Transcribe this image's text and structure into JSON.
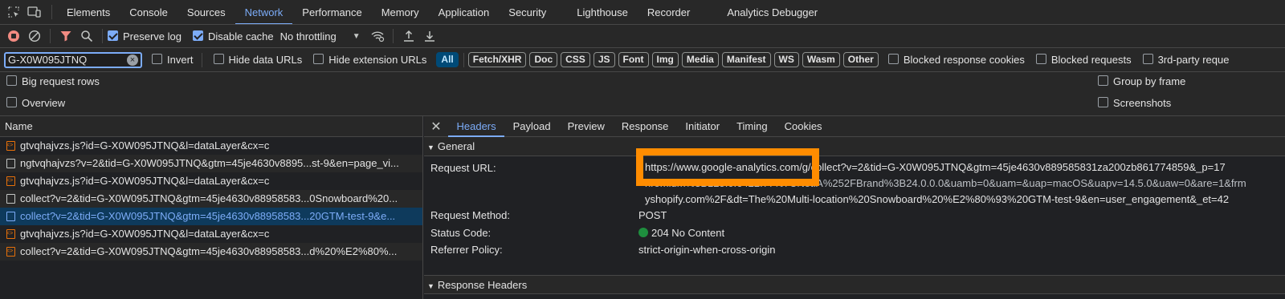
{
  "tabs": [
    "Elements",
    "Console",
    "Sources",
    "Network",
    "Performance",
    "Memory",
    "Application",
    "Security",
    "Lighthouse",
    "Recorder",
    "Analytics Debugger"
  ],
  "active_tab": "Network",
  "toolbar": {
    "preserve_log": "Preserve log",
    "disable_cache": "Disable cache",
    "throttling": "No throttling"
  },
  "filter": {
    "value": "G-X0W095JTNQ",
    "invert": "Invert",
    "hide_data_urls": "Hide data URLs",
    "hide_extension_urls": "Hide extension URLs",
    "types": [
      "All",
      "Fetch/XHR",
      "Doc",
      "CSS",
      "JS",
      "Font",
      "Img",
      "Media",
      "Manifest",
      "WS",
      "Wasm",
      "Other"
    ],
    "blocked_cookies": "Blocked response cookies",
    "blocked_requests": "Blocked requests",
    "third_party": "3rd-party reque"
  },
  "options": {
    "big_rows": "Big request rows",
    "overview": "Overview",
    "group_by_frame": "Group by frame",
    "screenshots": "Screenshots"
  },
  "requests": {
    "header": "Name",
    "items": [
      "gtvqhajvzs.js?id=G-X0W095JTNQ&l=dataLayer&cx=c",
      "ngtvqhajvzs?v=2&tid=G-X0W095JTNQ&gtm=45je4630v8895...st-9&en=page_vi...",
      "gtvqhajvzs.js?id=G-X0W095JTNQ&l=dataLayer&cx=c",
      "collect?v=2&tid=G-X0W095JTNQ&gtm=45je4630v88958583...0Snowboard%20...",
      "collect?v=2&tid=G-X0W095JTNQ&gtm=45je4630v88958583...20GTM-test-9&e...",
      "gtvqhajvzs.js?id=G-X0W095JTNQ&l=dataLayer&cx=c",
      "collect?v=2&tid=G-X0W095JTNQ&gtm=45je4630v88958583...d%20%E2%80%..."
    ]
  },
  "details": {
    "tabs": [
      "Headers",
      "Payload",
      "Preview",
      "Response",
      "Initiator",
      "Timing",
      "Cookies"
    ],
    "general_title": "General",
    "request_url_label": "Request URL:",
    "request_url_lines": [
      "https://www.google-analytics.com/g/collect?v=2&tid=G-X0W095JTNQ&gtm=45je4630v889585831za200zb861774859&_p=17",
      "hromium%3B125.0.6422.77%7CNot.A%252FBrand%3B24.0.0.0&uamb=0&uam=&uap=macOS&uapv=14.5.0&uaw=0&are=1&frm",
      "yshopify.com%2F&dt=The%20Multi-location%20Snowboard%20%E2%80%93%20GTM-test-9&en=user_engagement&_et=42"
    ],
    "method_label": "Request Method:",
    "method": "POST",
    "status_label": "Status Code:",
    "status": "204 No Content",
    "referrer_label": "Referrer Policy:",
    "referrer": "strict-origin-when-cross-origin",
    "response_headers_title": "Response Headers"
  }
}
